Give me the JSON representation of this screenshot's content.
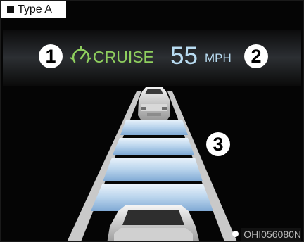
{
  "header": {
    "type_label": "Type A"
  },
  "callouts": {
    "one": "1",
    "two": "2",
    "three": "3"
  },
  "cruise": {
    "label": "CRUISE",
    "icon": "cruise-control-speedometer-icon",
    "color": "#8fcf5e"
  },
  "speed": {
    "value": "55",
    "unit": "MPH",
    "color": "#b9dcf2"
  },
  "distance_bars": {
    "total": 4,
    "lit": 4,
    "color": "#bcd7ee"
  },
  "watermark": "OHI056080N"
}
